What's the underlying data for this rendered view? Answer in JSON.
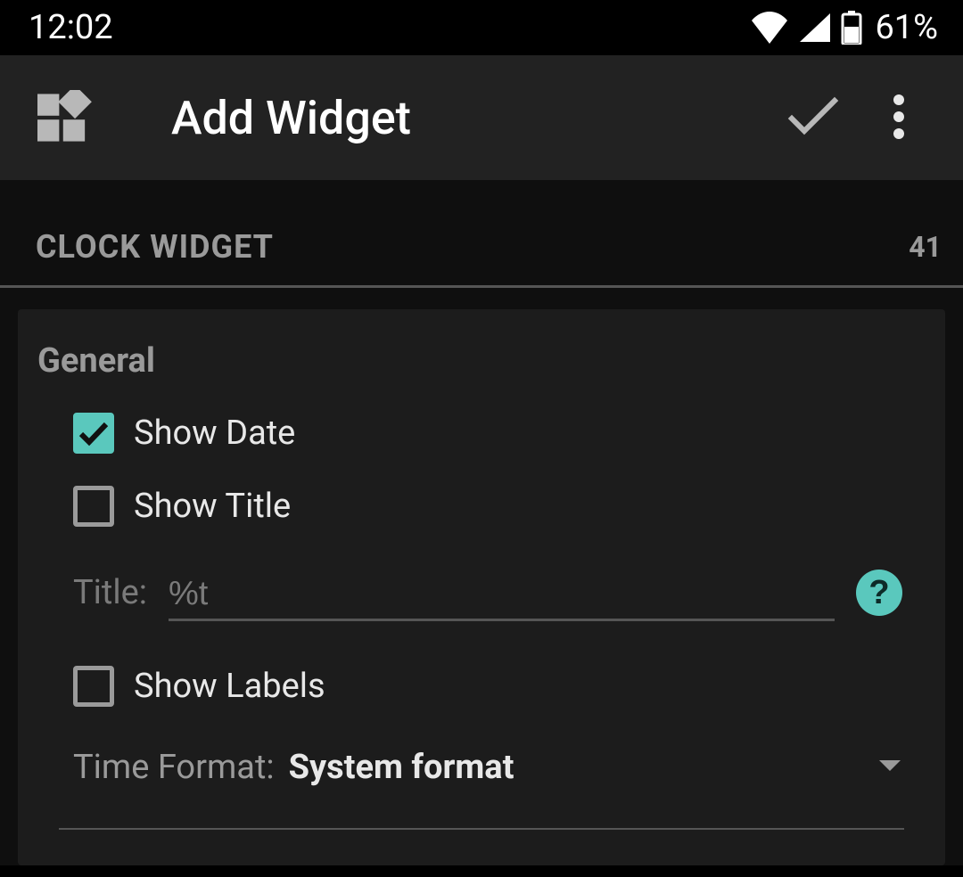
{
  "status": {
    "time": "12:02",
    "battery": "61%"
  },
  "appbar": {
    "title": "Add Widget"
  },
  "section": {
    "title": "CLOCK WIDGET",
    "count": "41"
  },
  "general": {
    "title": "General",
    "show_date": {
      "label": "Show Date",
      "checked": true
    },
    "show_title": {
      "label": "Show Title",
      "checked": false
    },
    "title_field": {
      "label": "Title:",
      "value": "%t"
    },
    "help": "?",
    "show_labels": {
      "label": "Show Labels",
      "checked": false
    },
    "time_format": {
      "label": "Time Format:",
      "value": "System format"
    }
  },
  "colors": {
    "accent": "#5ac8bd"
  }
}
